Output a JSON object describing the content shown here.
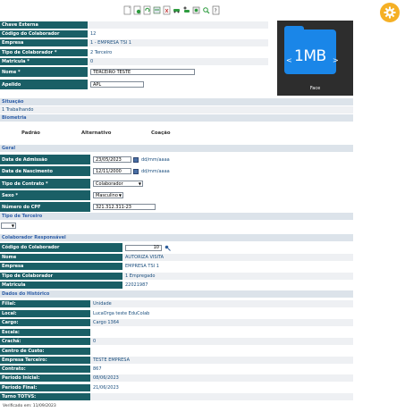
{
  "header": {
    "toolbar_icons": [
      "new-icon",
      "save-icon",
      "refresh-icon",
      "export-icon",
      "delete-icon",
      "car-icon",
      "person-car-icon",
      "settings-icon",
      "search-icon",
      "help-icon"
    ],
    "gear_icon": "gear-icon",
    "accent_color": "#f5b025"
  },
  "photo": {
    "file_size": "1MB",
    "caption": "Face"
  },
  "form": {
    "chave_externa": {
      "label": "Chave Externa",
      "value": ""
    },
    "codigo": {
      "label": "Código do Colaborador",
      "value": "12"
    },
    "empresa": {
      "label": "Empresa",
      "value": "1 - EMPRESA TSI 1"
    },
    "tipo": {
      "label": "Tipo de Colaborador *",
      "value": "2 Terceiro"
    },
    "matricula": {
      "label": "Matricula *",
      "value": "0"
    },
    "nome": {
      "label": "Nome *",
      "value": "TERCEIRO TESTE"
    },
    "apelido": {
      "label": "Apelido",
      "value": "APL"
    }
  },
  "situacao": {
    "title": "Situação",
    "value": "1 Trabalhando"
  },
  "biometria": {
    "title": "Biometria",
    "items": [
      "Padrão",
      "Alternativo",
      "Coação"
    ]
  },
  "geral": {
    "title": "Geral",
    "admissao": {
      "label": "Data de Admissão",
      "value": "23/05/2023",
      "hint": "dd/mm/aaaa"
    },
    "nascimento": {
      "label": "Data de Nascimento",
      "value": "12/11/2000",
      "hint": "dd/mm/aaaa"
    },
    "contrato": {
      "label": "Tipo de Contrato *",
      "value": "Colaborador"
    },
    "sexo": {
      "label": "Sexo *",
      "value": "Masculino"
    },
    "cpf": {
      "label": "Número do CPF",
      "value": "321.312.311-23"
    }
  },
  "tipo_terceiro": {
    "title": "Tipo de Terceiro",
    "value": ""
  },
  "responsavel": {
    "title": "Colaborador Responsável",
    "codigo": {
      "label": "Código do Colaborador",
      "value": "10"
    },
    "nome": {
      "label": "Nome",
      "value": "AUTORIZA VISITA"
    },
    "empresa": {
      "label": "Empresa",
      "value": "EMPRESA TSI 1"
    },
    "tipo": {
      "label": "Tipo de Colaborador",
      "value": "1 Empregado"
    },
    "matricula": {
      "label": "Matricula",
      "value": "22021987"
    }
  },
  "historico": {
    "title": "Dados do Histórico",
    "filial": {
      "label": "Filial:",
      "value": "Unidade"
    },
    "local": {
      "label": "Local:",
      "value": "LucaOrga teste EduColab"
    },
    "cargo": {
      "label": "Cargo:",
      "value": "Cargo 1364"
    },
    "escala": {
      "label": "Escala:",
      "value": ""
    },
    "cracha": {
      "label": "Crachá:",
      "value": "0"
    },
    "centro": {
      "label": "Centro de Custo:",
      "value": ""
    },
    "empresa_terceiro": {
      "label": "Empresa Terceiro:",
      "value": "TESTE EMPRESA"
    },
    "contrato": {
      "label": "Contrato:",
      "value": "867"
    },
    "periodo_inicial": {
      "label": "Período Inicial:",
      "value": "08/06/2023"
    },
    "periodo_final": {
      "label": "Período Final:",
      "value": "21/06/2023"
    },
    "turno": {
      "label": "Turno TOTVS:",
      "value": ""
    }
  },
  "footer": {
    "text": "Verificado em: 11/09/2023"
  }
}
